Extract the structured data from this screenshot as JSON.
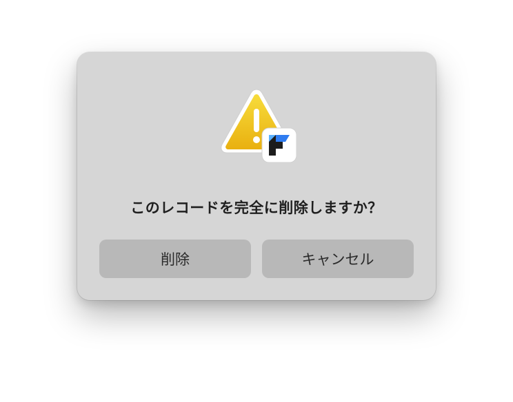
{
  "dialog": {
    "message": "このレコードを完全に削除しますか？",
    "icon": "warning-triangle-with-app-badge-icon",
    "buttons": {
      "delete_label": "削除",
      "cancel_label": "キャンセル"
    }
  },
  "colors": {
    "dialog_background": "#d6d6d6",
    "button_background": "#b8b8b8",
    "warning_yellow": "#f2c418",
    "text": "#1f1f1f"
  }
}
